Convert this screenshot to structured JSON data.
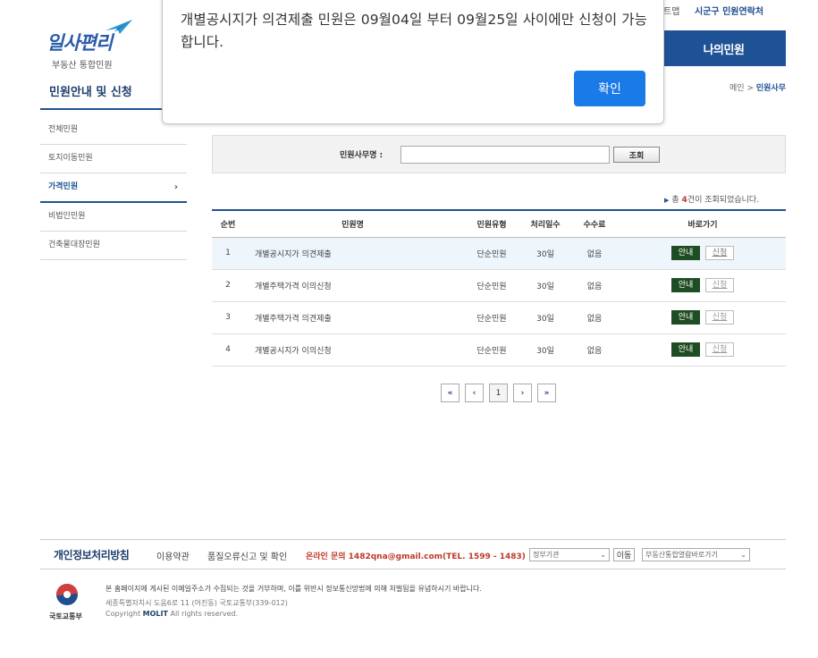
{
  "header": {
    "logo_text": "일사편리",
    "logo_sub": "부동산 통합민원",
    "top_link_partial": "트맵",
    "top_link_contact": "시군구 민원연락처",
    "my_civil_button": "나의민원",
    "breadcrumb_home": "메인 >",
    "breadcrumb_current": "민원사무"
  },
  "sidebar": {
    "title": "민원안내 및 신청",
    "items": [
      {
        "label": "전체민원"
      },
      {
        "label": "토지이동민원"
      },
      {
        "label": "가격민원",
        "active": true
      },
      {
        "label": "비법인민원"
      },
      {
        "label": "건축물대장민원"
      }
    ],
    "chevron": "›"
  },
  "search": {
    "label": "민원사무명 :",
    "value": "",
    "button": "조회"
  },
  "result": {
    "prefix": "총",
    "count": "4",
    "suffix": "건이 조회되었습니다."
  },
  "table": {
    "headers": [
      "순번",
      "민원명",
      "민원유형",
      "처리일수",
      "수수료",
      "바로가기"
    ],
    "rows": [
      {
        "no": "1",
        "name": "개별공시지가 의견제출",
        "type": "단순민원",
        "days": "30일",
        "fee": "없음",
        "guide": "안내",
        "apply": "신청"
      },
      {
        "no": "2",
        "name": "개별주택가격 이의신청",
        "type": "단순민원",
        "days": "30일",
        "fee": "없음",
        "guide": "안내",
        "apply": "신청"
      },
      {
        "no": "3",
        "name": "개별주택가격 의견제출",
        "type": "단순민원",
        "days": "30일",
        "fee": "없음",
        "guide": "안내",
        "apply": "신청"
      },
      {
        "no": "4",
        "name": "개별공시지가 이의신청",
        "type": "단순민원",
        "days": "30일",
        "fee": "없음",
        "guide": "안내",
        "apply": "신청"
      }
    ]
  },
  "paging": {
    "first": "«",
    "prev": "‹",
    "current": "1",
    "next": "›",
    "last": "»"
  },
  "footer": {
    "privacy": "개인정보처리방침",
    "terms": "이용약관",
    "report": "품질오류신고 및 확인",
    "contact": "온라인 문의 1482qna@gmail.com(TEL. 1599 - 1483)",
    "gov_select": "정부기관",
    "move_button": "이동",
    "family_select": "부동산통합열람바로가기",
    "ministry": "국토교통부",
    "notice": "본 홈페이지에 게시된 이메일주소가 수집되는 것을 거부하며, 이를 위반시 정보통신망법에 의해 처벌됨을 유념하시기 바랍니다.",
    "address": "세종특별자치시 도움6로 11 (어진동) 국토교통부(339-012)",
    "copyright_pre": "Copyright",
    "copyright_brand": "MOLIT",
    "copyright_post": "All rights reserved."
  },
  "modal": {
    "message": "개별공시지가 의견제출 민원은 09월04일 부터 09월25일 사이에만 신청이 가능합니다.",
    "ok_button": "확인"
  },
  "colors": {
    "primary": "#1f5294",
    "guide_button": "#1f4d23",
    "modal_button": "#1a7ae8",
    "accent_red": "#c0392b"
  }
}
